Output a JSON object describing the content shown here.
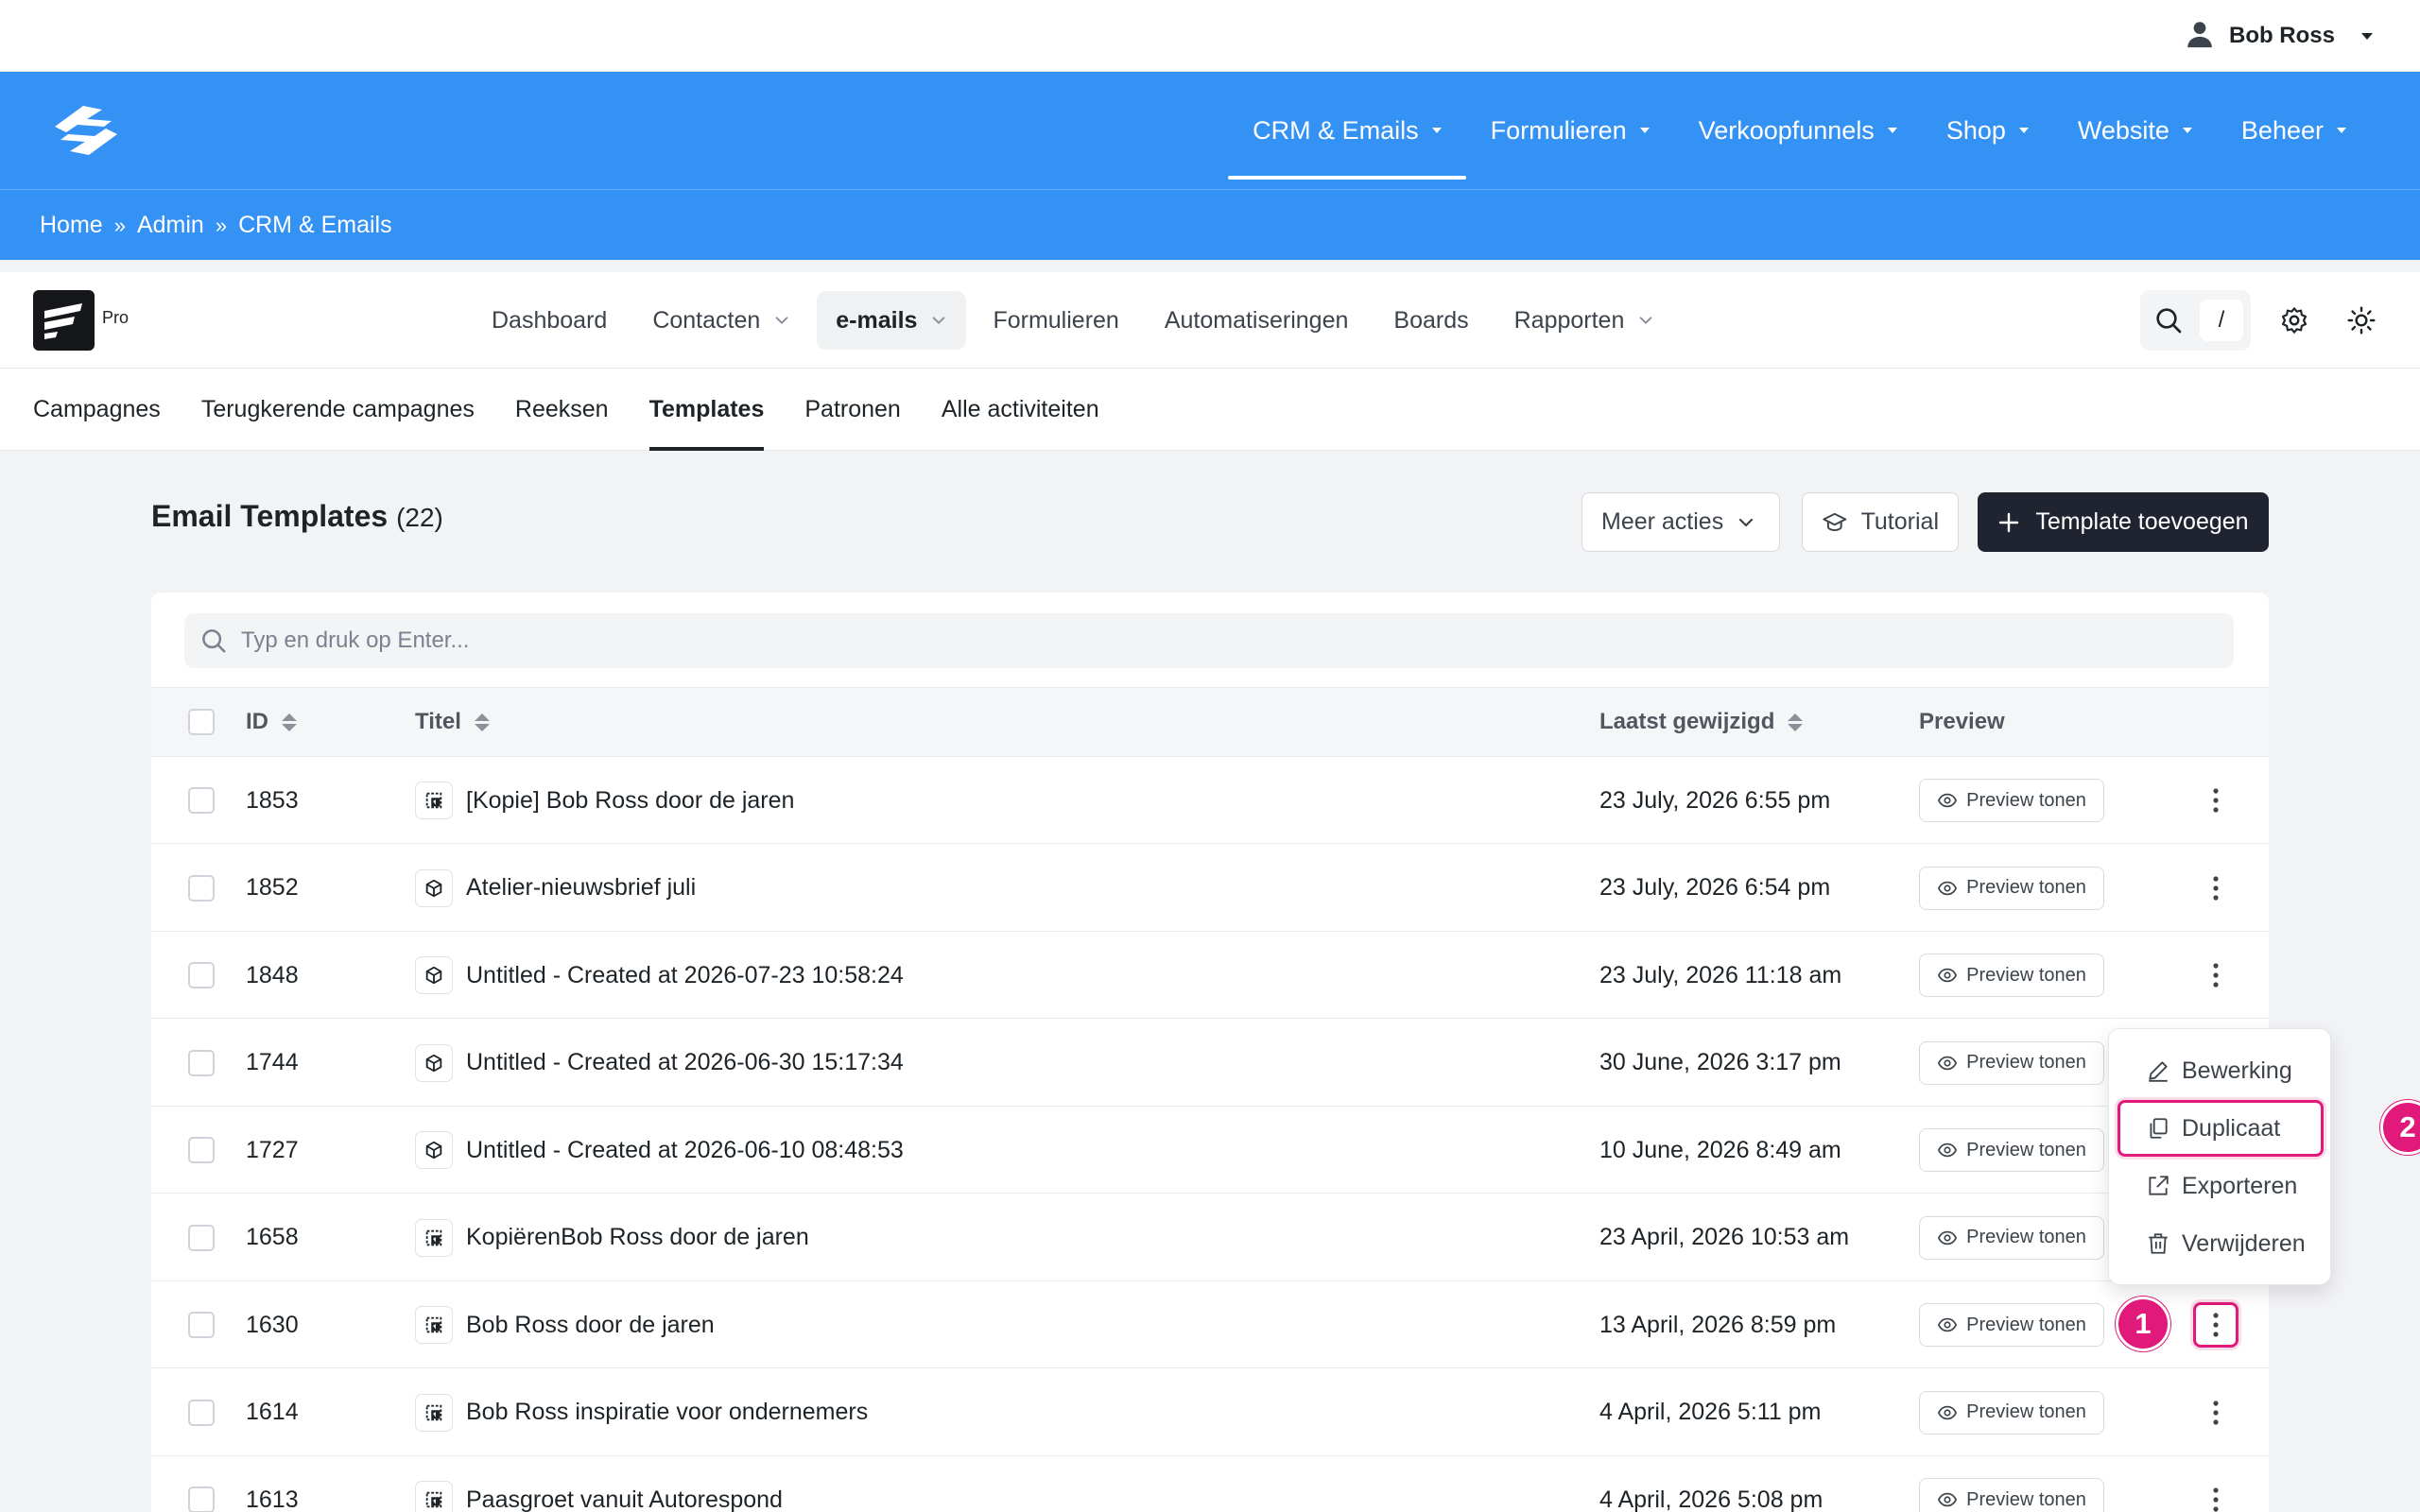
{
  "user": {
    "name": "Bob Ross",
    "icon": "user-icon"
  },
  "main_nav": {
    "items": [
      {
        "label": "CRM & Emails",
        "active": true
      },
      {
        "label": "Formulieren"
      },
      {
        "label": "Verkoopfunnels"
      },
      {
        "label": "Shop"
      },
      {
        "label": "Website"
      },
      {
        "label": "Beheer"
      }
    ]
  },
  "breadcrumb": [
    "Home",
    "Admin",
    "CRM & Emails"
  ],
  "breadcrumb_separator": "»",
  "app": {
    "badge": "Pro",
    "nav": [
      {
        "label": "Dashboard"
      },
      {
        "label": "Contacten",
        "has_dropdown": true
      },
      {
        "label": "e-mails",
        "has_dropdown": true,
        "active": true
      },
      {
        "label": "Formulieren"
      },
      {
        "label": "Automatiseringen"
      },
      {
        "label": "Boards"
      },
      {
        "label": "Rapporten",
        "has_dropdown": true
      }
    ],
    "search_shortcut": "/"
  },
  "sub_tabs": [
    {
      "label": "Campagnes"
    },
    {
      "label": "Terugkerende campagnes"
    },
    {
      "label": "Reeksen"
    },
    {
      "label": "Templates",
      "active": true
    },
    {
      "label": "Patronen"
    },
    {
      "label": "Alle activiteiten"
    }
  ],
  "page": {
    "title": "Email Templates",
    "count": "(22)",
    "more_actions": "Meer acties",
    "tutorial": "Tutorial",
    "add_button": "Template toevoegen"
  },
  "search": {
    "placeholder": "Typ en druk op Enter..."
  },
  "table": {
    "columns": {
      "id": "ID",
      "title": "Titel",
      "modified": "Laatst gewijzigd",
      "preview": "Preview"
    },
    "preview_label": "Preview tonen",
    "rows": [
      {
        "id": "1853",
        "title": "[Kopie] Bob Ross door de jaren",
        "modified": "23 July, 2026 6:55 pm",
        "type": "visual"
      },
      {
        "id": "1852",
        "title": "Atelier-nieuwsbrief juli",
        "modified": "23 July, 2026 6:54 pm",
        "type": "block"
      },
      {
        "id": "1848",
        "title": "Untitled - Created at 2026-07-23 10:58:24",
        "modified": "23 July, 2026 11:18 am",
        "type": "block"
      },
      {
        "id": "1744",
        "title": "Untitled - Created at 2026-06-30 15:17:34",
        "modified": "30 June, 2026 3:17 pm",
        "type": "block"
      },
      {
        "id": "1727",
        "title": "Untitled - Created at 2026-06-10 08:48:53",
        "modified": "10 June, 2026 8:49 am",
        "type": "block"
      },
      {
        "id": "1658",
        "title": "KopiërenBob Ross door de jaren",
        "modified": "23 April, 2026 10:53 am",
        "type": "visual"
      },
      {
        "id": "1630",
        "title": "Bob Ross door de jaren",
        "modified": "13 April, 2026 8:59 pm",
        "type": "visual"
      },
      {
        "id": "1614",
        "title": "Bob Ross inspiratie voor ondernemers",
        "modified": "4 April, 2026 5:11 pm",
        "type": "visual"
      },
      {
        "id": "1613",
        "title": "Paasgroet vanuit Autorespond",
        "modified": "4 April, 2026 5:08 pm",
        "type": "visual"
      }
    ]
  },
  "row_menu": {
    "items": [
      {
        "label": "Bewerking",
        "icon": "pencil-icon"
      },
      {
        "label": "Duplicaat",
        "icon": "copy-icon"
      },
      {
        "label": "Exporteren",
        "icon": "export-icon"
      },
      {
        "label": "Verwijderen",
        "icon": "trash-icon"
      }
    ]
  },
  "annotations": {
    "step1": "1",
    "step2": "2",
    "color": "#e0197b"
  },
  "colors": {
    "header_blue": "#3592f5",
    "dark_button": "#1f2430",
    "highlight": "#e0197b"
  }
}
